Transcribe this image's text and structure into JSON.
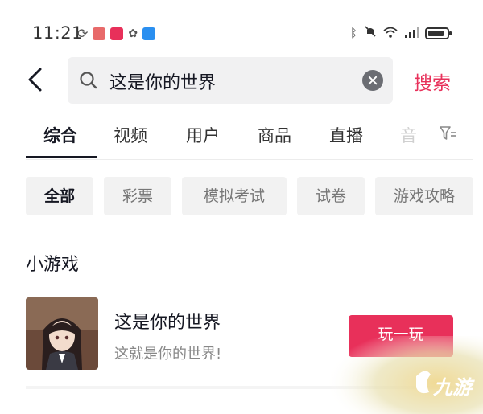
{
  "status_bar": {
    "time": "11:21",
    "left_icons": [
      "sync-icon",
      "app-icon",
      "app-icon",
      "app-icon",
      "app-icon"
    ],
    "right_icons": [
      "bluetooth-icon",
      "mute-icon",
      "wifi-icon",
      "signal-icon",
      "battery-icon"
    ]
  },
  "search": {
    "query": "这是你的世界",
    "submit_label": "搜索"
  },
  "tabs": [
    {
      "label": "综合",
      "active": true
    },
    {
      "label": "视频"
    },
    {
      "label": "用户"
    },
    {
      "label": "商品"
    },
    {
      "label": "直播"
    },
    {
      "label": "音"
    }
  ],
  "chips": [
    {
      "label": "全部",
      "active": true
    },
    {
      "label": "彩票"
    },
    {
      "label": "模拟考试"
    },
    {
      "label": "试卷"
    },
    {
      "label": "游戏攻略"
    }
  ],
  "section": {
    "title": "小游戏"
  },
  "game": {
    "title": "这是你的世界",
    "description": "这就是你的世界!",
    "play_label": "玩一玩"
  },
  "watermark": {
    "text": "九游"
  },
  "colors": {
    "accent": "#e8305a",
    "chip_bg": "#f2f2f2",
    "search_bg": "#f1f1f2",
    "text_primary": "#161823"
  }
}
